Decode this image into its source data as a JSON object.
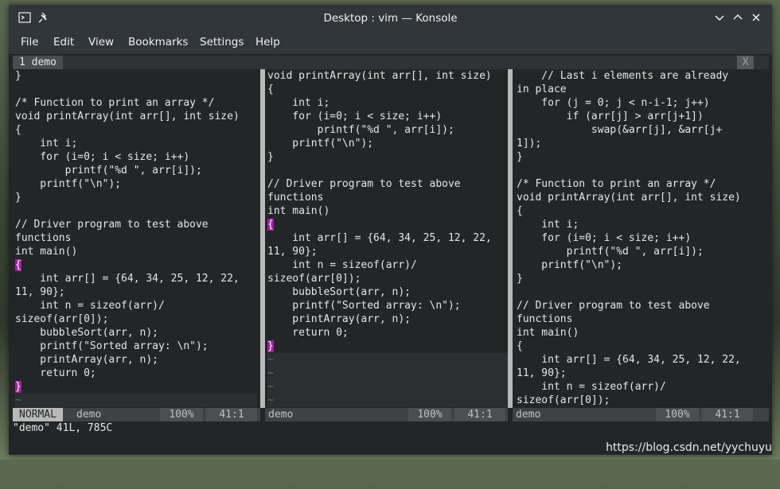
{
  "window": {
    "title": "Desktop : vim — Konsole",
    "icons": [
      "terminal-app-icon",
      "pin-icon",
      "minimize-icon",
      "maximize-icon",
      "close-icon"
    ]
  },
  "menu": [
    "File",
    "Edit",
    "View",
    "Bookmarks",
    "Settings",
    "Help"
  ],
  "tabline": {
    "tab": "1 demo",
    "close": "X"
  },
  "panes": [
    {
      "lines": [
        {
          "t": "}"
        },
        {
          "t": ""
        },
        {
          "t": "/* Function to print an array */"
        },
        {
          "t": "void printArray(int arr[], int size)"
        },
        {
          "t": "{"
        },
        {
          "t": "    int i;"
        },
        {
          "t": "    for (i=0; i < size; i++)"
        },
        {
          "t": "        printf(\"%d \", arr[i]);"
        },
        {
          "t": "    printf(\"\\n\");"
        },
        {
          "t": "}"
        },
        {
          "t": ""
        },
        {
          "t": "// Driver program to test above"
        },
        {
          "t": "functions"
        },
        {
          "t": "int main()"
        },
        {
          "t": "{",
          "hl": true
        },
        {
          "t": "    int arr[] = {64, 34, 25, 12, 22,"
        },
        {
          "t": "11, 90};"
        },
        {
          "t": "    int n = sizeof(arr)/"
        },
        {
          "t": "sizeof(arr[0]);"
        },
        {
          "t": "    bubbleSort(arr, n);"
        },
        {
          "t": "    printf(\"Sorted array: \\n\");"
        },
        {
          "t": "    printArray(arr, n);"
        },
        {
          "t": "    return 0;"
        },
        {
          "t": "}",
          "hl": true
        },
        {
          "t": "~",
          "tilde": true
        }
      ],
      "status": {
        "mode": "NORMAL",
        "file": "demo",
        "pct": "100%",
        "pos": "41:1"
      }
    },
    {
      "lines": [
        {
          "t": "void printArray(int arr[], int size)"
        },
        {
          "t": "{"
        },
        {
          "t": "    int i;"
        },
        {
          "t": "    for (i=0; i < size; i++)"
        },
        {
          "t": "        printf(\"%d \", arr[i]);"
        },
        {
          "t": "    printf(\"\\n\");"
        },
        {
          "t": "}"
        },
        {
          "t": ""
        },
        {
          "t": "// Driver program to test above"
        },
        {
          "t": "functions"
        },
        {
          "t": "int main()"
        },
        {
          "t": "{",
          "hl": true
        },
        {
          "t": "    int arr[] = {64, 34, 25, 12, 22,"
        },
        {
          "t": "11, 90};"
        },
        {
          "t": "    int n = sizeof(arr)/"
        },
        {
          "t": "sizeof(arr[0]);"
        },
        {
          "t": "    bubbleSort(arr, n);"
        },
        {
          "t": "    printf(\"Sorted array: \\n\");"
        },
        {
          "t": "    printArray(arr, n);"
        },
        {
          "t": "    return 0;"
        },
        {
          "t": "}",
          "hl": true
        },
        {
          "t": "~",
          "tilde": true
        },
        {
          "t": "~",
          "tilde": true
        },
        {
          "t": "~",
          "tilde": true
        },
        {
          "t": "~",
          "tilde": true
        }
      ],
      "status": {
        "file": "demo",
        "pct": "100%",
        "pos": "41:1"
      }
    },
    {
      "lines": [
        {
          "t": "    // Last i elements are already"
        },
        {
          "t": "in place"
        },
        {
          "t": "    for (j = 0; j < n-i-1; j++)"
        },
        {
          "t": "        if (arr[j] > arr[j+1])"
        },
        {
          "t": "            swap(&arr[j], &arr[j+"
        },
        {
          "t": "1]);"
        },
        {
          "t": "}"
        },
        {
          "t": ""
        },
        {
          "t": "/* Function to print an array */"
        },
        {
          "t": "void printArray(int arr[], int size)"
        },
        {
          "t": "{"
        },
        {
          "t": "    int i;"
        },
        {
          "t": "    for (i=0; i < size; i++)"
        },
        {
          "t": "        printf(\"%d \", arr[i]);"
        },
        {
          "t": "    printf(\"\\n\");"
        },
        {
          "t": "}"
        },
        {
          "t": ""
        },
        {
          "t": "// Driver program to test above"
        },
        {
          "t": "functions"
        },
        {
          "t": "int main()"
        },
        {
          "t": "{"
        },
        {
          "t": "    int arr[] = {64, 34, 25, 12, 22,"
        },
        {
          "t": "11, 90};"
        },
        {
          "t": "    int n = sizeof(arr)/"
        },
        {
          "t": "sizeof(arr[0]);"
        }
      ],
      "status": {
        "file": "demo",
        "pct": "100%",
        "pos": "41:1"
      }
    }
  ],
  "cmdline": "\"demo\" 41L, 785C",
  "watermark": "https://blog.csdn.net/yychuyu"
}
